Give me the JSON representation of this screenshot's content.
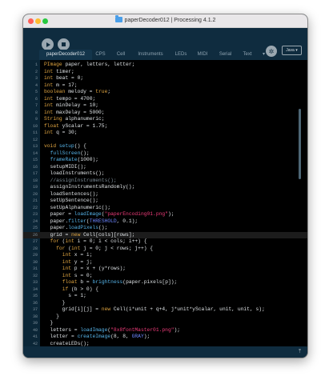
{
  "window": {
    "title": "paperDecoder012 | Processing 4.1.2"
  },
  "toolbar": {
    "mode_label": "Java ▾",
    "debug_glyph": "✲"
  },
  "tabs": [
    {
      "label": "paperDecoder012"
    },
    {
      "label": "CPS"
    },
    {
      "label": "Cell"
    },
    {
      "label": "Instruments"
    },
    {
      "label": "LEDs"
    },
    {
      "label": "MIDI"
    },
    {
      "label": "Serial"
    },
    {
      "label": "Text"
    }
  ],
  "tab_menu_glyph": "▾",
  "code": {
    "highlight_line": 26,
    "colors": {
      "keyword": "#e0a540",
      "func": "#57b6ec",
      "string": "#ef3c7a",
      "comment": "#7b8b96",
      "constant": "#6b86ff",
      "text": "#dde1e4"
    },
    "lines": [
      {
        "n": "1",
        "text": "PImage paper, letters, letter;"
      },
      {
        "n": "2",
        "text": "int timer;"
      },
      {
        "n": "3",
        "text": "int beat = 0;"
      },
      {
        "n": "4",
        "text": "int m = 17;"
      },
      {
        "n": "5",
        "text": "boolean melody = true;"
      },
      {
        "n": "6",
        "text": "int tempo = 4700;"
      },
      {
        "n": "7",
        "text": "int minDelay = 10;"
      },
      {
        "n": "8",
        "text": "int maxDelay = 5000;"
      },
      {
        "n": "9",
        "text": "String alphanumeric;"
      },
      {
        "n": "10",
        "text": "float yScalar = 1.75;"
      },
      {
        "n": "11",
        "text": "int q = 30;"
      },
      {
        "n": "12",
        "text": ""
      },
      {
        "n": "13",
        "text": "void setup() {"
      },
      {
        "n": "14",
        "text": "  fullScreen();"
      },
      {
        "n": "15",
        "text": "  frameRate(1000);"
      },
      {
        "n": "16",
        "text": "  setupMIDI();"
      },
      {
        "n": "17",
        "text": "  loadInstruments();"
      },
      {
        "n": "18",
        "text": "  //assignInstruments();"
      },
      {
        "n": "19",
        "text": "  assignInstrumentsRandomly();"
      },
      {
        "n": "20",
        "text": "  loadSentences();"
      },
      {
        "n": "21",
        "text": "  setUpSentence();"
      },
      {
        "n": "22",
        "text": "  setUpAlphanumeric();"
      },
      {
        "n": "23",
        "text": "  paper = loadImage(\"paperEncoding01.png\");"
      },
      {
        "n": "24",
        "text": "  paper.filter(THRESHOLD, 0.1);"
      },
      {
        "n": "25",
        "text": "  paper.loadPixels();"
      },
      {
        "n": "26",
        "text": "  grid = new Cell[cols][rows];"
      },
      {
        "n": "27",
        "text": "  for (int i = 0; i < cols; i++) {"
      },
      {
        "n": "28",
        "text": "    for (int j = 0; j < rows; j++) {"
      },
      {
        "n": "29",
        "text": "      int x = i;"
      },
      {
        "n": "30",
        "text": "      int y = j;"
      },
      {
        "n": "31",
        "text": "      int p = x + (y*rows);"
      },
      {
        "n": "32",
        "text": "      int s = 0;"
      },
      {
        "n": "33",
        "text": "      float b = brightness(paper.pixels[p]);"
      },
      {
        "n": "34",
        "text": "      if (b > 0) {"
      },
      {
        "n": "35",
        "text": "        s = 1;"
      },
      {
        "n": "36",
        "text": "      }"
      },
      {
        "n": "37",
        "text": "      grid[i][j] = new Cell(i*unit + q+4, j*unit*yScalar, unit, unit, s);"
      },
      {
        "n": "38",
        "text": "    }"
      },
      {
        "n": "39",
        "text": "  }"
      },
      {
        "n": "40",
        "text": "  letters = loadImage(\"8x8fontMaster01.png\");"
      },
      {
        "n": "41",
        "text": "  letter = createImage(8, 8, GRAY);"
      },
      {
        "n": "42",
        "text": "  createLEDs();"
      }
    ]
  },
  "statusbar": {
    "arrow_glyph": "⤒"
  }
}
